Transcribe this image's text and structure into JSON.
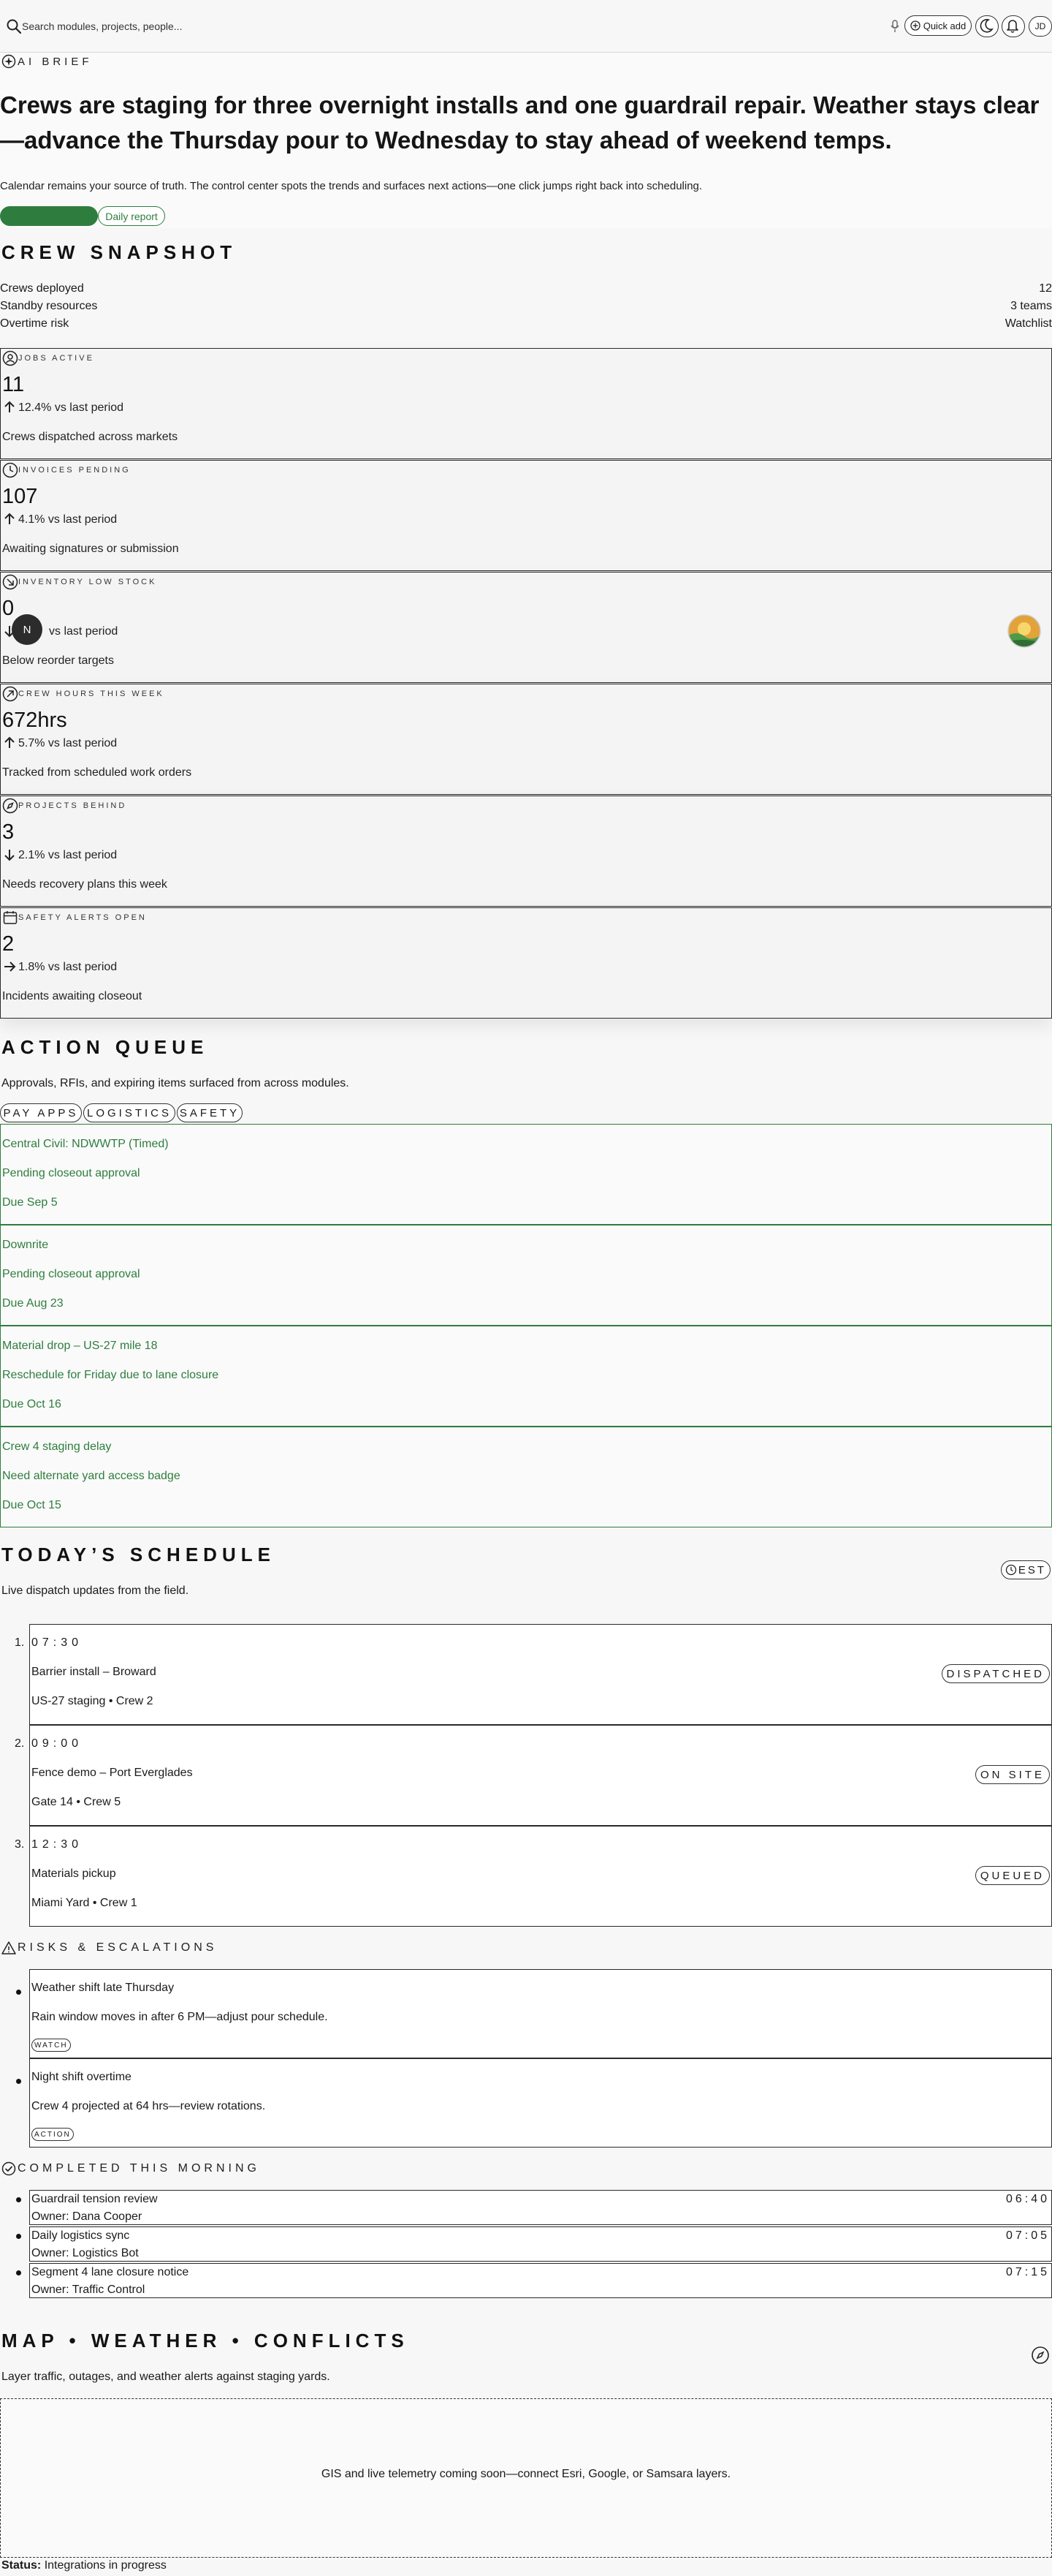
{
  "topbar": {
    "search_placeholder": "Search modules, projects, people...",
    "quick_add_label": "Quick add",
    "avatar_initials": "JD"
  },
  "brief": {
    "eyebrow": "AI BRIEF",
    "title": "Crews are staging for three overnight installs and one guardrail repair. Weather stays clear—advance the Thursday pour to Wednesday to stay ahead of weekend temps.",
    "subtitle": "Calendar remains your source of truth. The control center spots the trends and surfaces next actions—one click jumps right back into scheduling.",
    "report_label": "Daily report",
    "accent_color": "#2f7d3e"
  },
  "crew": {
    "title": "CREW SNAPSHOT",
    "rows": [
      {
        "label": "Crews deployed",
        "value": "12"
      },
      {
        "label": "Standby resources",
        "value": "3 teams"
      },
      {
        "label": "Overtime risk",
        "value": "Watchlist"
      }
    ]
  },
  "metrics": [
    {
      "icon": "user-badge-icon",
      "label": "JOBS ACTIVE",
      "value": "11",
      "trend_dir": "up",
      "trend": "12.4% vs last period",
      "desc": "Crews dispatched across markets"
    },
    {
      "icon": "clock-icon",
      "label": "INVOICES PENDING",
      "value": "107",
      "trend_dir": "up",
      "trend": "4.1% vs last period",
      "desc": "Awaiting signatures or submission"
    },
    {
      "icon": "arrow-down-right-circle-icon",
      "label": "INVENTORY LOW STOCK",
      "value": "0",
      "trend_dir": "down",
      "trend": "vs last period",
      "desc": "Below reorder targets"
    },
    {
      "icon": "arrow-up-right-circle-icon",
      "label": "CREW HOURS THIS WEEK",
      "value": "672hrs",
      "trend_dir": "up",
      "trend": "5.7% vs last period",
      "desc": "Tracked from scheduled work orders"
    },
    {
      "icon": "compass-icon",
      "label": "PROJECTS BEHIND",
      "value": "3",
      "trend_dir": "down",
      "trend": "2.1% vs last period",
      "desc": "Needs recovery plans this week"
    },
    {
      "icon": "calendar-icon",
      "label": "SAFETY ALERTS OPEN",
      "value": "2",
      "trend_dir": "right",
      "trend": "1.8% vs last period",
      "desc": "Incidents awaiting closeout"
    }
  ],
  "floating_button_label": "N",
  "actions": {
    "title": "ACTION QUEUE",
    "subtitle": "Approvals, RFIs, and expiring items surfaced from across modules.",
    "tabs": [
      "PAY APPS",
      "LOGISTICS",
      "SAFETY"
    ],
    "items": [
      {
        "title": "Central Civil: NDWWTP (Timed)",
        "detail": "Pending closeout approval",
        "due": "Due Sep 5"
      },
      {
        "title": "Downrite",
        "detail": "Pending closeout approval",
        "due": "Due Aug 23"
      },
      {
        "title": "Material drop – US-27 mile 18",
        "detail": "Reschedule for Friday due to lane closure",
        "due": "Due Oct 16"
      },
      {
        "title": "Crew 4 staging delay",
        "detail": "Need alternate yard access badge",
        "due": "Due Oct 15"
      }
    ]
  },
  "schedule": {
    "title": "TODAY’S SCHEDULE",
    "subtitle": "Live dispatch updates from the field.",
    "timezone": "EST",
    "items": [
      {
        "num": "1.",
        "time": "07:30",
        "title": "Barrier install – Broward",
        "meta": "US-27 staging • Crew 2",
        "status": "DISPATCHED"
      },
      {
        "num": "2.",
        "time": "09:00",
        "title": "Fence demo – Port Everglades",
        "meta": "Gate 14 • Crew 5",
        "status": "ON SITE"
      },
      {
        "num": "3.",
        "time": "12:30",
        "title": "Materials pickup",
        "meta": "Miami Yard • Crew 1",
        "status": "QUEUED"
      }
    ]
  },
  "risks": {
    "title": "RISKS & ESCALATIONS",
    "items": [
      {
        "title": "Weather shift late Thursday",
        "desc": "Rain window moves in after 6 PM—adjust pour schedule.",
        "tag": "WATCH"
      },
      {
        "title": "Night shift overtime",
        "desc": "Crew 4 projected at 64 hrs—review rotations.",
        "tag": "ACTION"
      }
    ]
  },
  "completed": {
    "title": "COMPLETED THIS MORNING",
    "items": [
      {
        "title": "Guardrail tension review",
        "owner": "Owner: Dana Cooper",
        "time": "06:40"
      },
      {
        "title": "Daily logistics sync",
        "owner": "Owner: Logistics Bot",
        "time": "07:05"
      },
      {
        "title": "Segment 4 lane closure notice",
        "owner": "Owner: Traffic Control",
        "time": "07:15"
      }
    ]
  },
  "map": {
    "title": "MAP • WEATHER • CONFLICTS",
    "subtitle": "Layer traffic, outages, and weather alerts against staging yards.",
    "placeholder": "GIS and live telemetry coming soon—connect Esri, Google, or Samsara layers."
  },
  "status": {
    "label": "Status:",
    "value": "Integrations in progress"
  }
}
